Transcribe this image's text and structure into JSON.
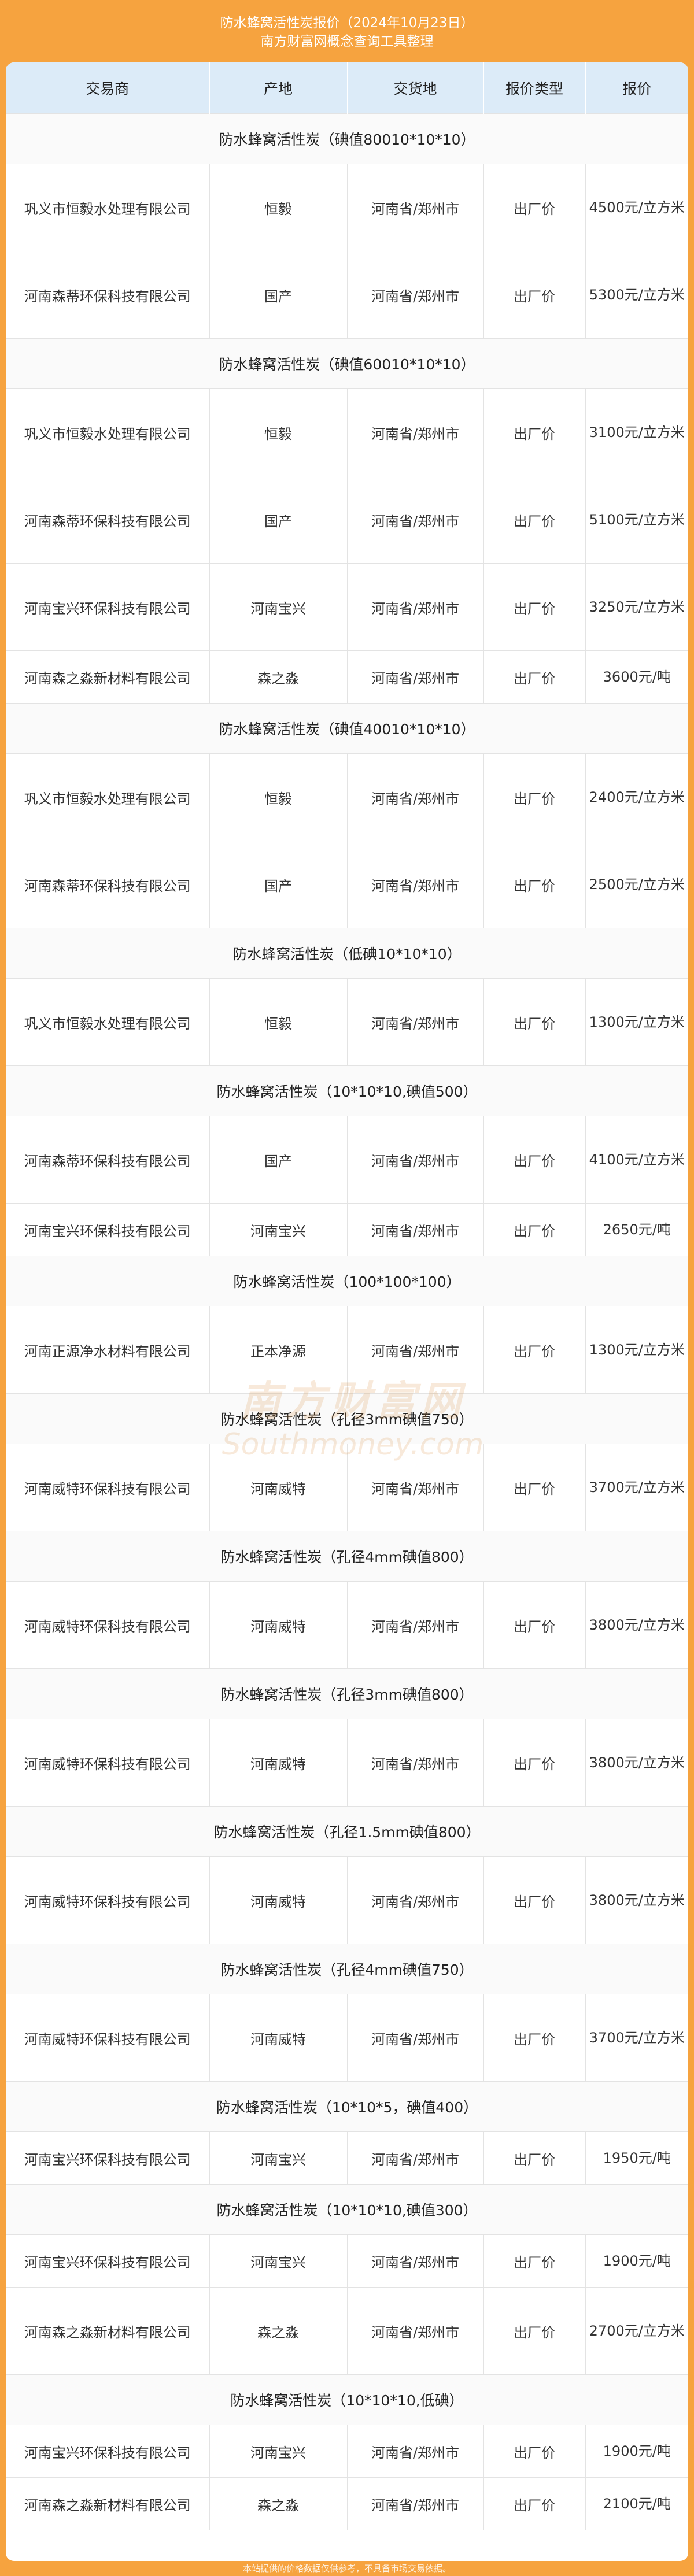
{
  "header": {
    "title": "防水蜂窝活性炭报价（2024年10月23日）",
    "subtitle": "南方财富网概念查询工具整理"
  },
  "columns": [
    "交易商",
    "产地",
    "交货地",
    "报价类型",
    "报价"
  ],
  "groups": [
    {
      "name": "防水蜂窝活性炭（碘值80010*10*10）",
      "rows": [
        [
          "巩义市恒毅水处理有限公司",
          "恒毅",
          "河南省/郑州市",
          "出厂价",
          "4500元/立方米"
        ],
        [
          "河南森蒂环保科技有限公司",
          "国产",
          "河南省/郑州市",
          "出厂价",
          "5300元/立方米"
        ]
      ]
    },
    {
      "name": "防水蜂窝活性炭（碘值60010*10*10）",
      "rows": [
        [
          "巩义市恒毅水处理有限公司",
          "恒毅",
          "河南省/郑州市",
          "出厂价",
          "3100元/立方米"
        ],
        [
          "河南森蒂环保科技有限公司",
          "国产",
          "河南省/郑州市",
          "出厂价",
          "5100元/立方米"
        ],
        [
          "河南宝兴环保科技有限公司",
          "河南宝兴",
          "河南省/郑州市",
          "出厂价",
          "3250元/立方米"
        ],
        [
          "河南森之淼新材料有限公司",
          "森之淼",
          "河南省/郑州市",
          "出厂价",
          "3600元/吨"
        ]
      ]
    },
    {
      "name": "防水蜂窝活性炭（碘值40010*10*10）",
      "rows": [
        [
          "巩义市恒毅水处理有限公司",
          "恒毅",
          "河南省/郑州市",
          "出厂价",
          "2400元/立方米"
        ],
        [
          "河南森蒂环保科技有限公司",
          "国产",
          "河南省/郑州市",
          "出厂价",
          "2500元/立方米"
        ]
      ]
    },
    {
      "name": "防水蜂窝活性炭（低碘10*10*10）",
      "rows": [
        [
          "巩义市恒毅水处理有限公司",
          "恒毅",
          "河南省/郑州市",
          "出厂价",
          "1300元/立方米"
        ]
      ]
    },
    {
      "name": "防水蜂窝活性炭（10*10*10,碘值500）",
      "rows": [
        [
          "河南森蒂环保科技有限公司",
          "国产",
          "河南省/郑州市",
          "出厂价",
          "4100元/立方米"
        ],
        [
          "河南宝兴环保科技有限公司",
          "河南宝兴",
          "河南省/郑州市",
          "出厂价",
          "2650元/吨"
        ]
      ]
    },
    {
      "name": "防水蜂窝活性炭（100*100*100）",
      "rows": [
        [
          "河南正源净水材料有限公司",
          "正本净源",
          "河南省/郑州市",
          "出厂价",
          "1300元/立方米"
        ]
      ]
    },
    {
      "name": "防水蜂窝活性炭（孔径3mm碘值750）",
      "rows": [
        [
          "河南威特环保科技有限公司",
          "河南威特",
          "河南省/郑州市",
          "出厂价",
          "3700元/立方米"
        ]
      ]
    },
    {
      "name": "防水蜂窝活性炭（孔径4mm碘值800）",
      "rows": [
        [
          "河南威特环保科技有限公司",
          "河南威特",
          "河南省/郑州市",
          "出厂价",
          "3800元/立方米"
        ]
      ]
    },
    {
      "name": "防水蜂窝活性炭（孔径3mm碘值800）",
      "rows": [
        [
          "河南威特环保科技有限公司",
          "河南威特",
          "河南省/郑州市",
          "出厂价",
          "3800元/立方米"
        ]
      ]
    },
    {
      "name": "防水蜂窝活性炭（孔径1.5mm碘值800）",
      "rows": [
        [
          "河南威特环保科技有限公司",
          "河南威特",
          "河南省/郑州市",
          "出厂价",
          "3800元/立方米"
        ]
      ]
    },
    {
      "name": "防水蜂窝活性炭（孔径4mm碘值750）",
      "rows": [
        [
          "河南威特环保科技有限公司",
          "河南威特",
          "河南省/郑州市",
          "出厂价",
          "3700元/立方米"
        ]
      ]
    },
    {
      "name": "防水蜂窝活性炭（10*10*5，碘值400）",
      "rows": [
        [
          "河南宝兴环保科技有限公司",
          "河南宝兴",
          "河南省/郑州市",
          "出厂价",
          "1950元/吨"
        ]
      ]
    },
    {
      "name": "防水蜂窝活性炭（10*10*10,碘值300）",
      "rows": [
        [
          "河南宝兴环保科技有限公司",
          "河南宝兴",
          "河南省/郑州市",
          "出厂价",
          "1900元/吨"
        ],
        [
          "河南森之淼新材料有限公司",
          "森之淼",
          "河南省/郑州市",
          "出厂价",
          "2700元/立方米"
        ]
      ]
    },
    {
      "name": "防水蜂窝活性炭（10*10*10,低碘）",
      "rows": [
        [
          "河南宝兴环保科技有限公司",
          "河南宝兴",
          "河南省/郑州市",
          "出厂价",
          "1900元/吨"
        ],
        [
          "河南森之淼新材料有限公司",
          "森之淼",
          "河南省/郑州市",
          "出厂价",
          "2100元/吨"
        ]
      ]
    }
  ],
  "watermark": {
    "line1": "南方财富网",
    "line2": "Southmoney.com"
  },
  "footer": "本站提供的价格数据仅供参考，不具备市场交易依据。"
}
